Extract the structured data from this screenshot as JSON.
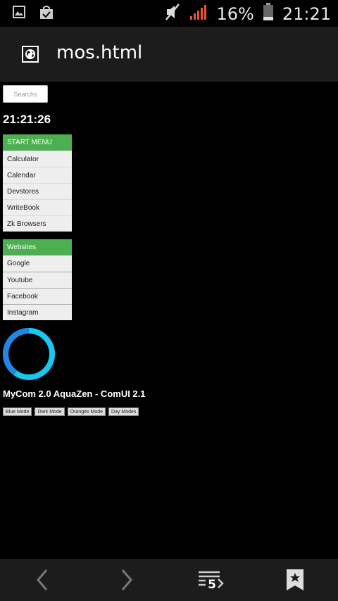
{
  "status_bar": {
    "battery_percent": "16%",
    "time": "21:21"
  },
  "app_header": {
    "title": "mos.html"
  },
  "search": {
    "placeholder": "Searchs"
  },
  "clock": {
    "time": "21:21:26"
  },
  "start_menu": {
    "title": "START MENU",
    "items": [
      {
        "label": "Calculator"
      },
      {
        "label": "Calendar"
      },
      {
        "label": "Devstores"
      },
      {
        "label": "WriteBook"
      },
      {
        "label": "Zk Browsers"
      }
    ]
  },
  "websites_menu": {
    "title": "Websites",
    "items": [
      {
        "label": "Google"
      },
      {
        "label": "Youtube"
      },
      {
        "label": "Facebook"
      },
      {
        "label": "Instagram"
      }
    ]
  },
  "loading_ring": {
    "colors": {
      "primary": "#1e88e5",
      "secondary": "#18c8f0"
    }
  },
  "brand": {
    "text": "MyCom 2.0 AquaZen - ComUI 2.1"
  },
  "modes": [
    {
      "label": "Blue Mode"
    },
    {
      "label": "Dark Mode"
    },
    {
      "label": "Oranges Mode"
    },
    {
      "label": "Day Modes"
    }
  ],
  "bottom_bar": {
    "tabs_count": "5",
    "icons": [
      "back-arrow-icon",
      "forward-arrow-icon",
      "tabs-icon",
      "bookmark-icon"
    ]
  },
  "colors": {
    "accent_green": "#4caf50",
    "header_bg": "#1c1c1c",
    "background": "#000000"
  }
}
